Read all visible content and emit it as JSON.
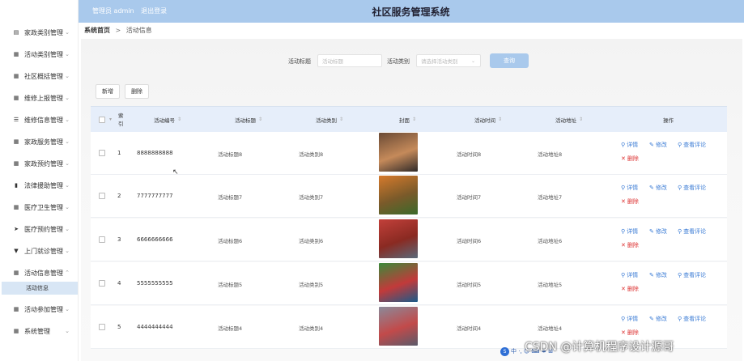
{
  "header": {
    "admin_text": "管理员 admin",
    "logout": "退出登录",
    "title": "社区服务管理系统"
  },
  "sidebar": {
    "items": [
      {
        "label": "家政类别管理",
        "icon": "doc-icon",
        "glyph": "▤",
        "expanded": false
      },
      {
        "label": "活动类别管理",
        "icon": "grid-icon",
        "glyph": "▦",
        "expanded": false
      },
      {
        "label": "社区概括管理",
        "icon": "grid-icon",
        "glyph": "▦",
        "expanded": false
      },
      {
        "label": "维修上报管理",
        "icon": "table-icon",
        "glyph": "▦",
        "expanded": false
      },
      {
        "label": "维修信息管理",
        "icon": "sliders-icon",
        "glyph": "☰",
        "expanded": false
      },
      {
        "label": "家政服务管理",
        "icon": "grid-icon",
        "glyph": "▦",
        "expanded": false
      },
      {
        "label": "家政预约管理",
        "icon": "grid-icon",
        "glyph": "▦",
        "expanded": false
      },
      {
        "label": "法律援助管理",
        "icon": "bar-chart-icon",
        "glyph": "▮",
        "expanded": false
      },
      {
        "label": "医疗卫生管理",
        "icon": "grid-icon",
        "glyph": "▦",
        "expanded": false
      },
      {
        "label": "医疗预约管理",
        "icon": "send-icon",
        "glyph": "➤",
        "expanded": false
      },
      {
        "label": "上门就诊管理",
        "icon": "pin-icon",
        "glyph": "▼",
        "expanded": false
      },
      {
        "label": "活动信息管理",
        "icon": "grid-icon",
        "glyph": "▦",
        "expanded": true
      },
      {
        "label": "活动参加管理",
        "icon": "grid-icon",
        "glyph": "▦",
        "expanded": false
      },
      {
        "label": "系统管理",
        "icon": "grid-icon",
        "glyph": "▦",
        "expanded": false
      }
    ],
    "sub_item": "活动信息"
  },
  "breadcrumb": {
    "home": "系统首页",
    "separator": ">",
    "current": "活动信息"
  },
  "search": {
    "title_label": "活动标题",
    "title_placeholder": "活动标题",
    "type_label": "活动类别",
    "type_placeholder": "请选择活动类别",
    "query_button": "查询"
  },
  "toolbar": {
    "add": "新增",
    "delete": "删除"
  },
  "table": {
    "headers": {
      "index": "索引",
      "code": "活动编号",
      "title": "活动标题",
      "type": "活动类别",
      "cover": "封面",
      "time": "活动时间",
      "address": "活动地址",
      "ops": "操作"
    },
    "rows": [
      {
        "index": "1",
        "code": "8888888888",
        "title": "活动标题8",
        "type": "活动类别8",
        "time": "活动时间8",
        "address": "活动地址8",
        "cover_colors": [
          "#6a4a35",
          "#c58a5a",
          "#2f2a28"
        ]
      },
      {
        "index": "2",
        "code": "7777777777",
        "title": "活动标题7",
        "type": "活动类别7",
        "time": "活动时间7",
        "address": "活动地址7",
        "cover_colors": [
          "#d67a2c",
          "#7a5a2a",
          "#3a6a2a"
        ]
      },
      {
        "index": "3",
        "code": "6666666666",
        "title": "活动标题6",
        "type": "活动类别6",
        "time": "活动时间6",
        "address": "活动地址6",
        "cover_colors": [
          "#c2403a",
          "#8a2a22",
          "#5a6a7a"
        ]
      },
      {
        "index": "4",
        "code": "5555555555",
        "title": "活动标题5",
        "type": "活动类别5",
        "time": "活动时间5",
        "address": "活动地址5",
        "cover_colors": [
          "#3a8a3a",
          "#c23a3a",
          "#1a5a8a"
        ]
      },
      {
        "index": "5",
        "code": "4444444444",
        "title": "活动标题4",
        "type": "活动类别4",
        "time": "活动时间4",
        "address": "活动地址4",
        "cover_colors": [
          "#8a8a9a",
          "#c24a4a",
          "#5a5a6a"
        ]
      }
    ],
    "ops": {
      "detail": "详情",
      "edit": "修改",
      "comments": "查看评论",
      "delete": "删除"
    }
  },
  "watermark": "CSDN @计算机程序设计源哥",
  "ime": {
    "logo": "S",
    "text": "中 ·, ☺ ⌨ ♠ ⊞"
  }
}
